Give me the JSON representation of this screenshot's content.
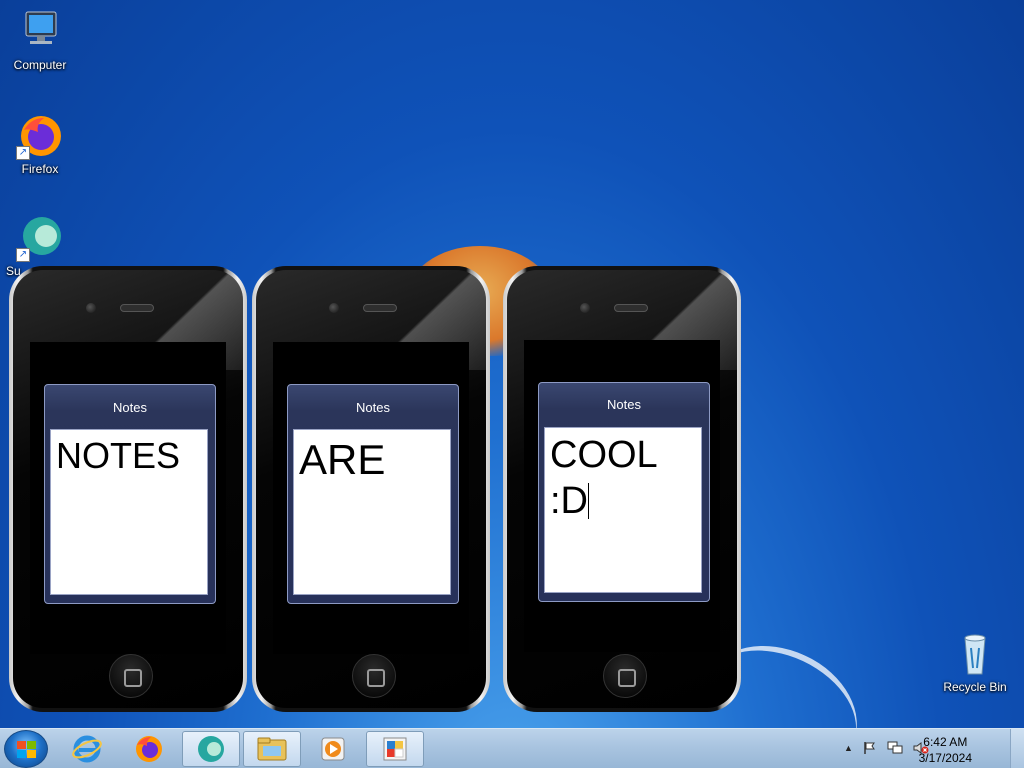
{
  "desktop": {
    "icons": [
      {
        "label": "Computer"
      },
      {
        "label": "Firefox"
      },
      {
        "label": "Su"
      },
      {
        "label": "Recycle Bin"
      }
    ]
  },
  "widgets": [
    {
      "title": "Notes",
      "text": "NOTES"
    },
    {
      "title": "Notes",
      "text": "ARE"
    },
    {
      "title": "Notes",
      "text": "COOL\n:D"
    }
  ],
  "taskbar": {
    "clock_time": "6:42 AM",
    "clock_date": "3/17/2024",
    "tray_arrow": "▲"
  },
  "colors": {
    "desktop_blue": "#1f6fd0",
    "widget_header": "#2b355a",
    "taskbar": "#a9c4e0"
  }
}
